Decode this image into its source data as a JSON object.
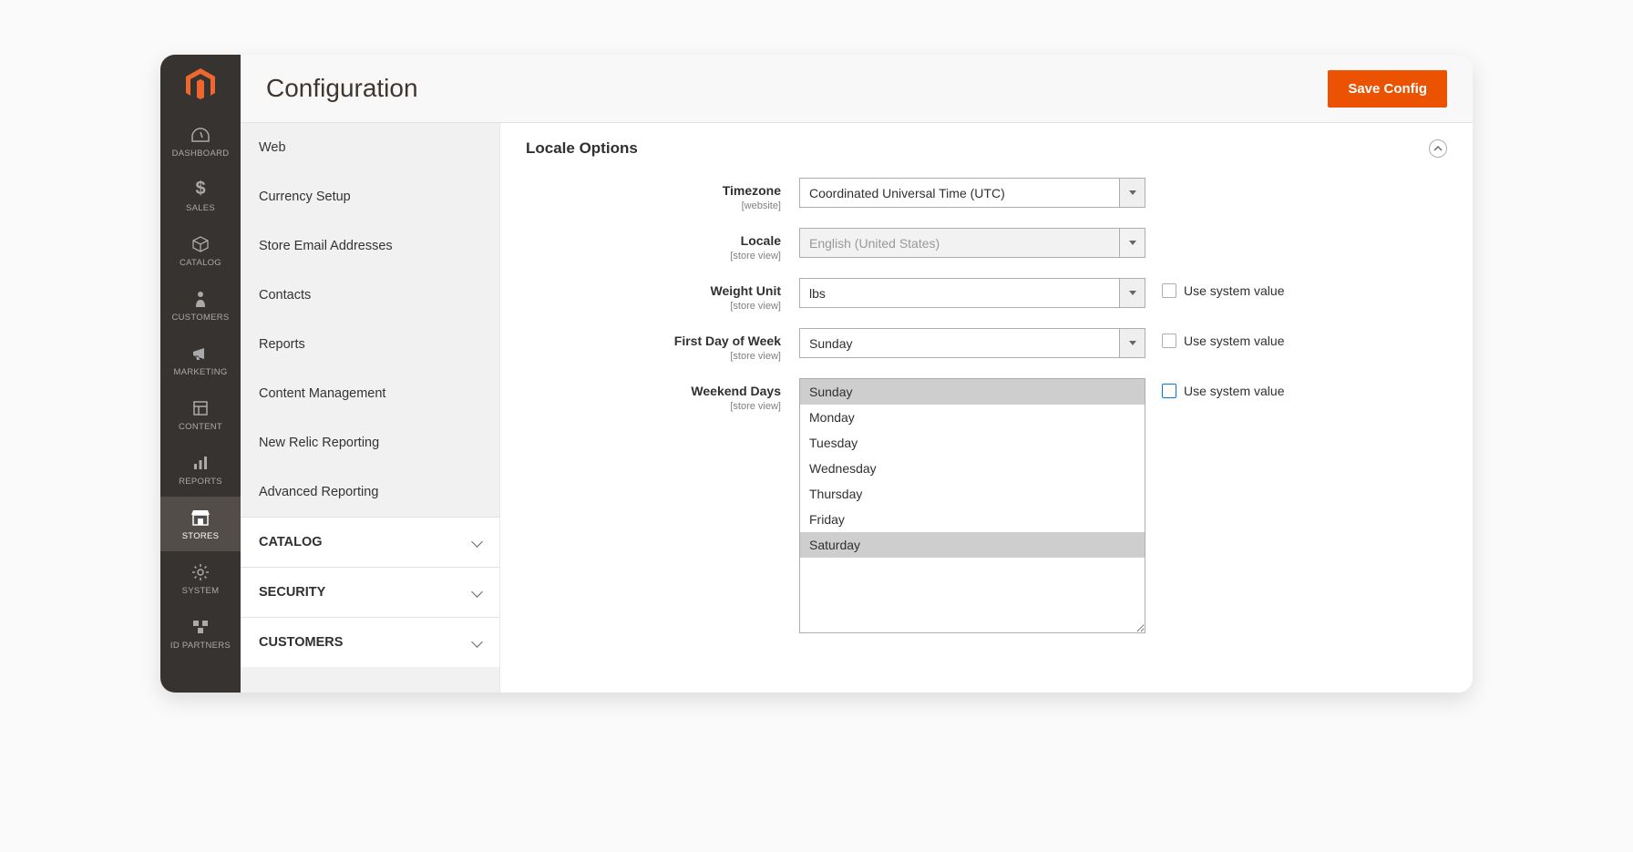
{
  "header": {
    "title": "Configuration",
    "save_button": "Save Config"
  },
  "nav": [
    {
      "label": "DASHBOARD",
      "icon": "dashboard"
    },
    {
      "label": "SALES",
      "icon": "dollar"
    },
    {
      "label": "CATALOG",
      "icon": "box"
    },
    {
      "label": "CUSTOMERS",
      "icon": "person"
    },
    {
      "label": "MARKETING",
      "icon": "megaphone"
    },
    {
      "label": "CONTENT",
      "icon": "layout"
    },
    {
      "label": "REPORTS",
      "icon": "bars"
    },
    {
      "label": "STORES",
      "icon": "store",
      "active": true
    },
    {
      "label": "SYSTEM",
      "icon": "gear"
    },
    {
      "label": "ID PARTNERS",
      "icon": "blocks"
    }
  ],
  "config_tabs": {
    "general_items": [
      "Web",
      "Currency Setup",
      "Store Email Addresses",
      "Contacts",
      "Reports",
      "Content Management",
      "New Relic Reporting",
      "Advanced Reporting"
    ],
    "groups": [
      "CATALOG",
      "SECURITY",
      "CUSTOMERS"
    ]
  },
  "section": {
    "title": "Locale Options",
    "fields": {
      "timezone": {
        "label": "Timezone",
        "scope": "[website]",
        "value": "Coordinated Universal Time (UTC)"
      },
      "locale": {
        "label": "Locale",
        "scope": "[store view]",
        "value": "English (United States)"
      },
      "weight_unit": {
        "label": "Weight Unit",
        "scope": "[store view]",
        "value": "lbs",
        "use_system_label": "Use system value"
      },
      "first_day": {
        "label": "First Day of Week",
        "scope": "[store view]",
        "value": "Sunday",
        "use_system_label": "Use system value"
      },
      "weekend": {
        "label": "Weekend Days",
        "scope": "[store view]",
        "options": [
          "Sunday",
          "Monday",
          "Tuesday",
          "Wednesday",
          "Thursday",
          "Friday",
          "Saturday"
        ],
        "selected": [
          "Sunday",
          "Saturday"
        ],
        "use_system_label": "Use system value"
      }
    }
  }
}
